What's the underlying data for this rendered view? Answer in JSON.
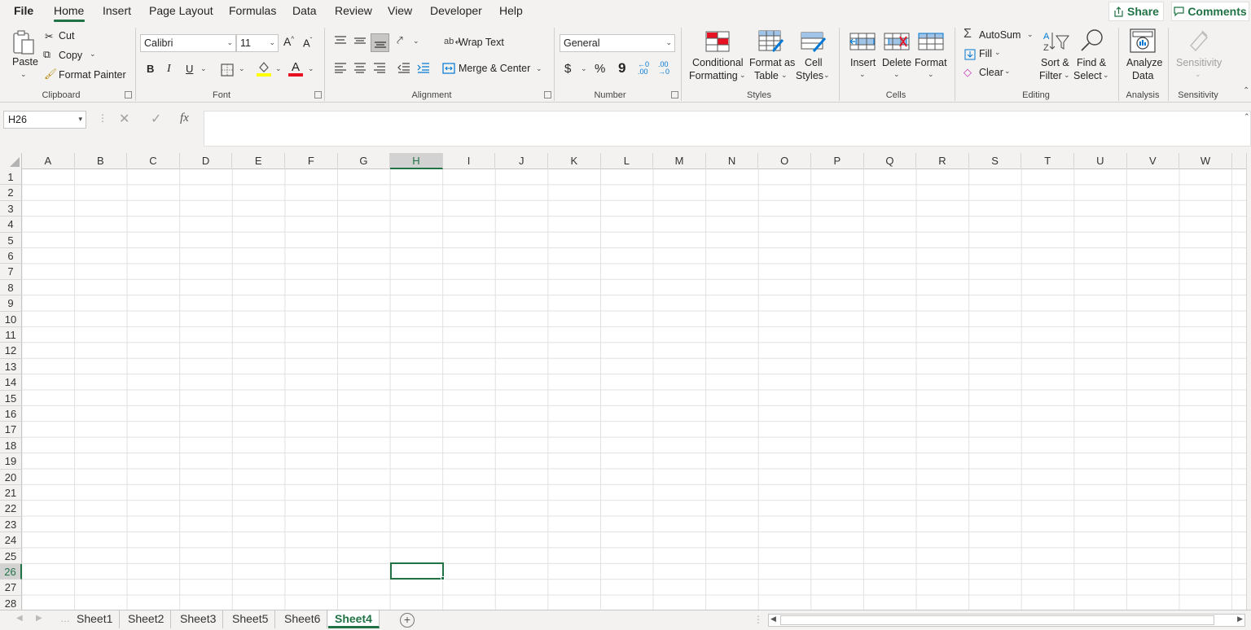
{
  "menu": {
    "tabs": [
      "File",
      "Home",
      "Insert",
      "Page Layout",
      "Formulas",
      "Data",
      "Review",
      "View",
      "Developer",
      "Help"
    ],
    "active_tab": "Home",
    "share_label": "Share",
    "comments_label": "Comments"
  },
  "ribbon": {
    "clipboard": {
      "paste": "Paste",
      "cut": "Cut",
      "copy": "Copy",
      "format_painter": "Format Painter",
      "label": "Clipboard"
    },
    "font": {
      "family": "Calibri",
      "size": "11",
      "bold": "B",
      "italic": "I",
      "underline": "U",
      "label": "Font",
      "grow": "A",
      "shrink": "A",
      "font_color_letter": "A"
    },
    "alignment": {
      "wrap_text": "Wrap Text",
      "merge_center": "Merge & Center",
      "label": "Alignment"
    },
    "number": {
      "format": "General",
      "currency": "$",
      "percent": "%",
      "comma": "9",
      "label": "Number"
    },
    "styles": {
      "conditional": "Conditional",
      "formatting": "Formatting",
      "format_as": "Format as",
      "table": "Table",
      "cell": "Cell",
      "cell_styles": "Styles",
      "label": "Styles"
    },
    "cells": {
      "insert": "Insert",
      "delete": "Delete",
      "format": "Format",
      "label": "Cells"
    },
    "editing": {
      "autosum": "AutoSum",
      "fill": "Fill",
      "clear": "Clear",
      "sort": "Sort &",
      "filter": "Filter",
      "find": "Find &",
      "select": "Select",
      "label": "Editing"
    },
    "analysis": {
      "analyze": "Analyze",
      "data": "Data",
      "label": "Analysis"
    },
    "sensitivity": {
      "name": "Sensitivity",
      "label": "Sensitivity"
    }
  },
  "formula_bar": {
    "name_box": "H26",
    "fx": "fx",
    "value": ""
  },
  "grid": {
    "columns": [
      "A",
      "B",
      "C",
      "D",
      "E",
      "F",
      "G",
      "H",
      "I",
      "J",
      "K",
      "L",
      "M",
      "N",
      "O",
      "P",
      "Q",
      "R",
      "S",
      "T",
      "U",
      "V",
      "W"
    ],
    "rows": [
      "1",
      "2",
      "3",
      "4",
      "5",
      "6",
      "7",
      "8",
      "9",
      "10",
      "11",
      "12",
      "13",
      "14",
      "15",
      "16",
      "17",
      "18",
      "19",
      "20",
      "21",
      "22",
      "23",
      "24",
      "25",
      "26",
      "27",
      "28"
    ],
    "selected_column": "H",
    "selected_row": "26"
  },
  "sheets": {
    "tabs": [
      "Sheet1",
      "Sheet2",
      "Sheet3",
      "Sheet5",
      "Sheet6",
      "Sheet4"
    ],
    "active": "Sheet4"
  },
  "colors": {
    "accent": "#217346",
    "ribbon_bg": "#f3f2f1"
  }
}
